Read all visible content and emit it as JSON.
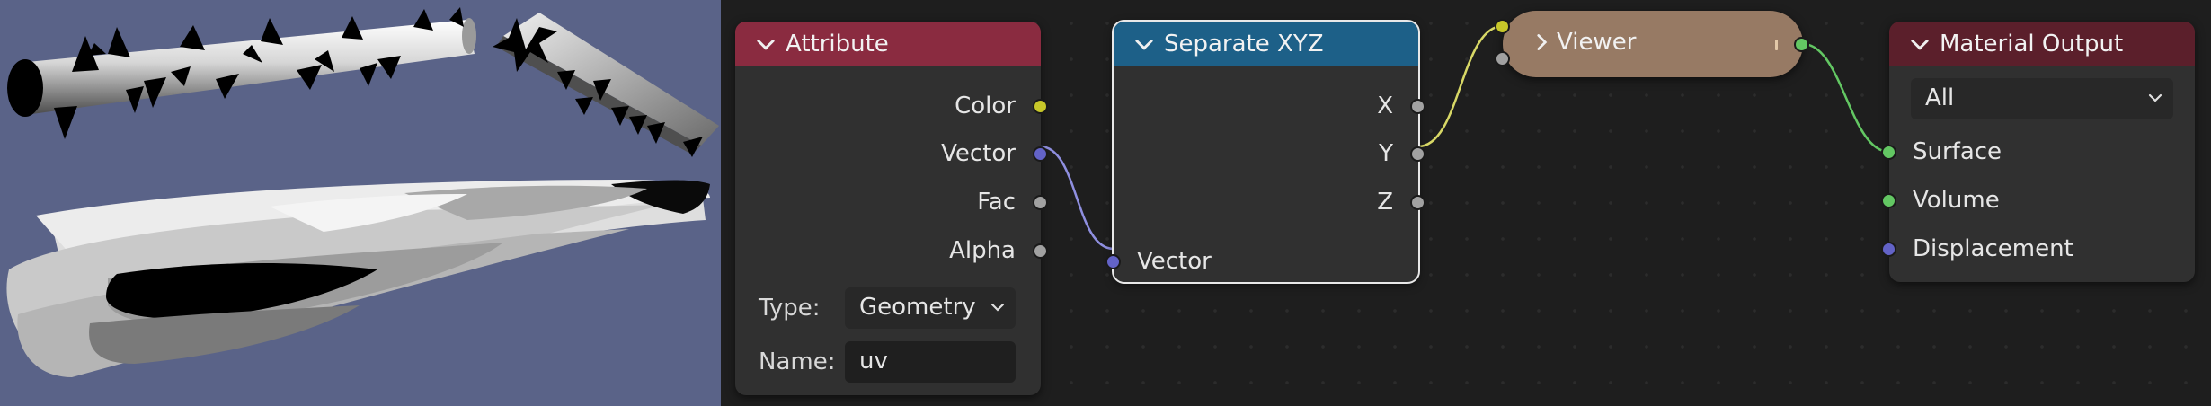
{
  "nodes": {
    "attribute": {
      "title": "Attribute",
      "header_color": "#8a2b40",
      "outputs": [
        "Color",
        "Vector",
        "Fac",
        "Alpha"
      ],
      "type_label": "Type:",
      "type_value": "Geometry",
      "name_label": "Name:",
      "name_value": "uv"
    },
    "separate_xyz": {
      "title": "Separate XYZ",
      "header_color": "#1d6088",
      "outputs": [
        "X",
        "Y",
        "Z"
      ],
      "input": "Vector"
    },
    "viewer": {
      "title": "Viewer",
      "color": "#977a64"
    },
    "material_output": {
      "title": "Material Output",
      "header_color": "#5b1f2b",
      "target_value": "All",
      "inputs": [
        "Surface",
        "Volume",
        "Displacement"
      ]
    }
  },
  "colors": {
    "socket_color": "#c7c729",
    "socket_vector": "#6363c7",
    "socket_float": "#a1a1a1",
    "socket_shader": "#63c763",
    "viewport_bg": "#5a6388"
  },
  "icons": [
    "chevron-down-icon",
    "chevron-right-icon",
    "dropdown-arrow-icon"
  ]
}
